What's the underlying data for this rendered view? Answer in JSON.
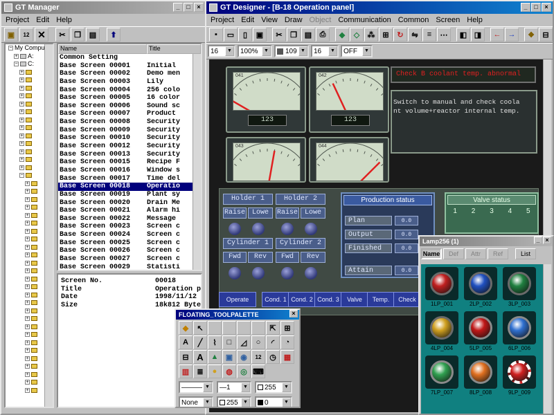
{
  "manager": {
    "title": "GT Manager",
    "menu": [
      "Project",
      "Edit",
      "Help"
    ],
    "tree": {
      "root": "My Comput",
      "drives": [
        "A:",
        "C:"
      ]
    },
    "list_headers": [
      "Name",
      "Title"
    ],
    "rows": [
      {
        "name": "Common Setting",
        "title": ""
      },
      {
        "name": "Base Screen 00001",
        "title": "Initial"
      },
      {
        "name": "Base Screen 00002",
        "title": "Demo men"
      },
      {
        "name": "Base Screen 00003",
        "title": "Lily"
      },
      {
        "name": "Base Screen 00004",
        "title": "256 colo"
      },
      {
        "name": "Base Screen 00005",
        "title": "16 color"
      },
      {
        "name": "Base Screen 00006",
        "title": "Sound sc"
      },
      {
        "name": "Base Screen 00007",
        "title": "Product"
      },
      {
        "name": "Base Screen 00008",
        "title": "Security"
      },
      {
        "name": "Base Screen 00009",
        "title": "Security"
      },
      {
        "name": "Base Screen 00010",
        "title": "Security"
      },
      {
        "name": "Base Screen 00012",
        "title": "Security"
      },
      {
        "name": "Base Screen 00013",
        "title": "Security"
      },
      {
        "name": "Base Screen 00015",
        "title": "Recipe F"
      },
      {
        "name": "Base Screen 00016",
        "title": "Window s"
      },
      {
        "name": "Base Screen 00017",
        "title": "Time del"
      },
      {
        "name": "Base Screen 00018",
        "title": "Operatio"
      },
      {
        "name": "Base Screen 00019",
        "title": "Plant sy"
      },
      {
        "name": "Base Screen 00020",
        "title": "Drain Me"
      },
      {
        "name": "Base Screen 00021",
        "title": "Alarm hi"
      },
      {
        "name": "Base Screen 00022",
        "title": "Message"
      },
      {
        "name": "Base Screen 00023",
        "title": "Screen c"
      },
      {
        "name": "Base Screen 00024",
        "title": "Screen c"
      },
      {
        "name": "Base Screen 00025",
        "title": "Screen c"
      },
      {
        "name": "Base Screen 00026",
        "title": "Screen c"
      },
      {
        "name": "Base Screen 00027",
        "title": "Screen c"
      },
      {
        "name": "Base Screen 00029",
        "title": "Statisti"
      }
    ],
    "selected_row": "Base Screen 00018",
    "props": [
      {
        "k": "Screen No.",
        "v": "00018"
      },
      {
        "k": "Title",
        "v": "Operation p"
      },
      {
        "k": "Date",
        "v": "1998/11/12"
      },
      {
        "k": "Size",
        "v": "18k812 Byte"
      }
    ]
  },
  "designer": {
    "title": "GT Designer - [B-18 Operation panel]",
    "menu": [
      "Project",
      "Edit",
      "View",
      "Draw",
      "Object",
      "Communication",
      "Common",
      "Screen",
      "Help"
    ],
    "combos": [
      "16",
      "100%",
      "109",
      "16",
      "OFF"
    ],
    "alarm_text": "Check B coolant temp. abnormal",
    "alarm_msg_1": "Switch to manual and check coola",
    "alarm_msg_2": "nt volume+reactor internal temp.",
    "meters": [
      {
        "tag": "041",
        "value": "123",
        "needle": -60
      },
      {
        "tag": "042",
        "value": "123",
        "needle": -25
      },
      {
        "tag": "043",
        "value": "",
        "needle": 10
      },
      {
        "tag": "044",
        "value": "",
        "needle": 45
      }
    ],
    "holders": [
      "Holder 1",
      "Holder 2"
    ],
    "raise": "Raise",
    "lower": "Lowe",
    "cylinders": [
      "Cylinder 1",
      "Cylinder 2"
    ],
    "fwd": "Fwd",
    "rev": "Rev",
    "production": {
      "title": "Production status",
      "rows": [
        "Plan",
        "Output",
        "Finished",
        "Attain"
      ],
      "value": "0.0"
    },
    "valve": {
      "title": "Valve status",
      "numbers": [
        "1",
        "2",
        "3",
        "4",
        "5"
      ]
    },
    "bottom_buttons": [
      "Operate",
      "Cond. 1",
      "Cond. 2",
      "Cond. 3",
      "Valve",
      "Temp.",
      "Check"
    ]
  },
  "toolpalette": {
    "title": "FLOATING_TOOLPALETTE",
    "width_value": "1",
    "color_value": "255",
    "fill_value": "None",
    "fill_color": "255",
    "back_color": "0"
  },
  "lamp": {
    "title": "Lamp256 (1)",
    "tabs": [
      "Name",
      "Def",
      "Attr",
      "Ref"
    ],
    "list_button": "List",
    "items": [
      {
        "label": "1LP_001",
        "color": "#c02020",
        "ring": "#6a6a6a"
      },
      {
        "label": "2LP_002",
        "color": "#2050c0",
        "ring": "#6a6a6a"
      },
      {
        "label": "3LP_003",
        "color": "#208040",
        "ring": "#6a6a6a"
      },
      {
        "label": "4LP_004",
        "color": "#d0a020",
        "ring": "#6a6a6a"
      },
      {
        "label": "5LP_005",
        "color": "#c01818",
        "ring": "#8a8a8a"
      },
      {
        "label": "6LP_006",
        "color": "#3070d0",
        "ring": "#8a8a8a"
      },
      {
        "label": "7LP_007",
        "color": "#30a050",
        "ring": "#8a8a8a"
      },
      {
        "label": "8LP_008",
        "color": "#e07020",
        "ring": "#8a8a8a"
      },
      {
        "label": "9LP_009",
        "color": "#d02020",
        "ring": "#ffffff"
      }
    ]
  }
}
